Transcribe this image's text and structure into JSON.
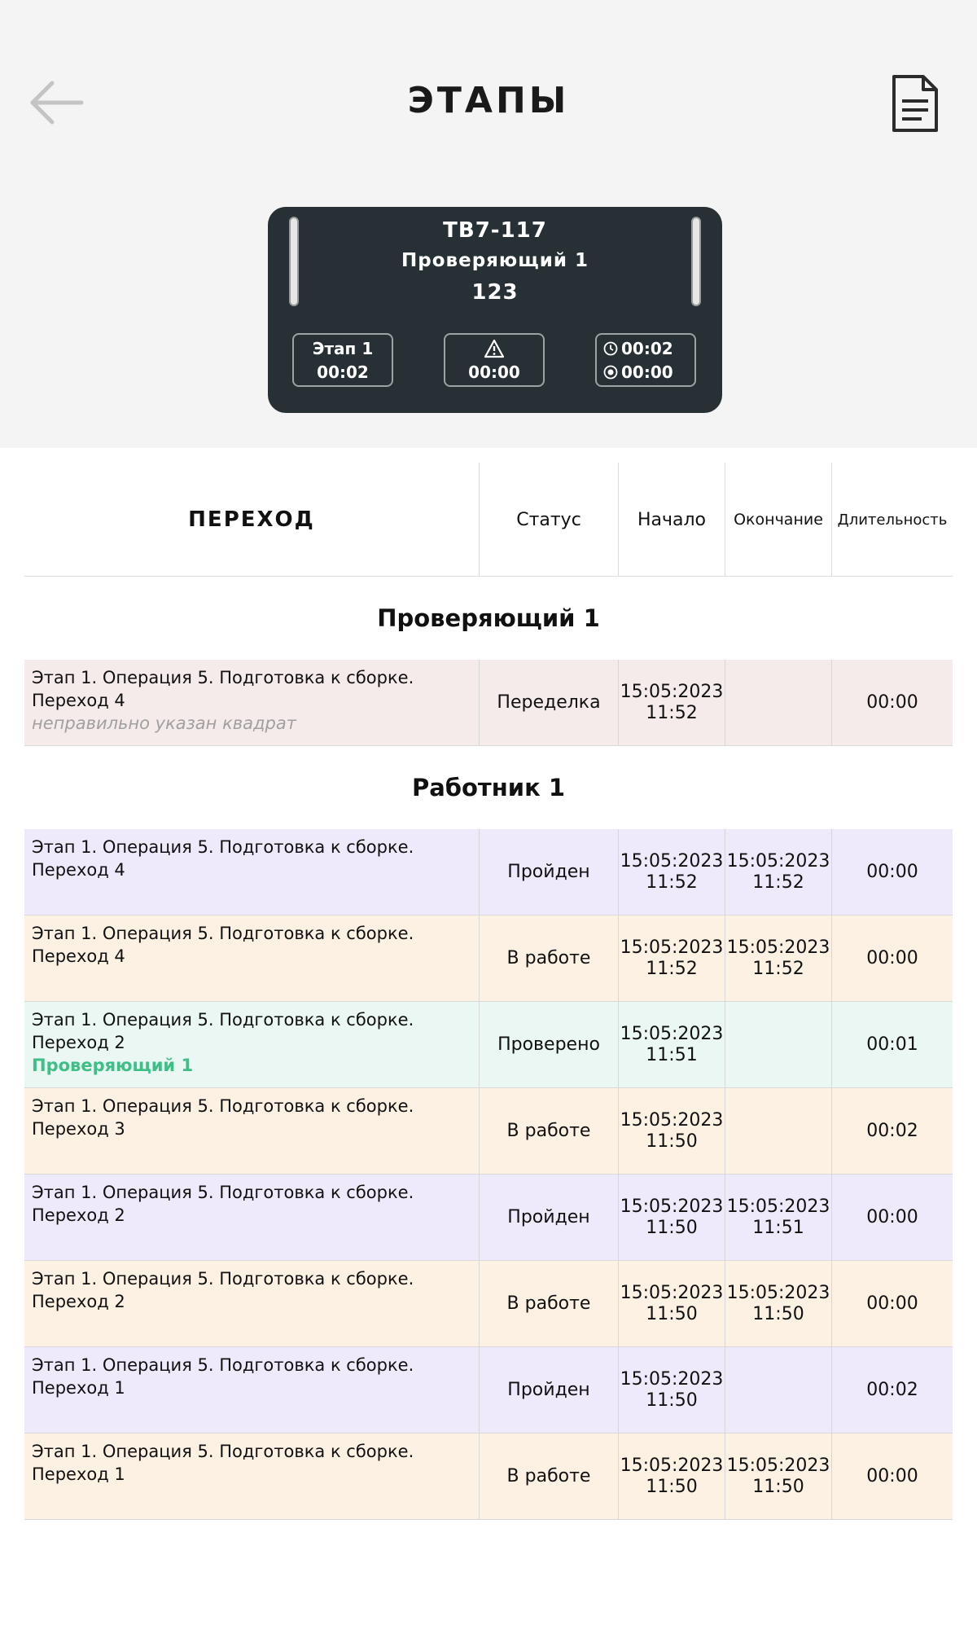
{
  "header": {
    "title": "ЭТАПЫ",
    "back_icon": "arrow-left-icon",
    "doc_icon": "document-icon"
  },
  "card": {
    "line1": "ТВ7-117",
    "line2": "Проверяющий 1",
    "line3": "123",
    "stage_label": "Этап 1",
    "stage_time": "00:02",
    "warning_time": "00:00",
    "clock_time": "00:02",
    "record_time": "00:00"
  },
  "table": {
    "headers": [
      "ПЕРЕХОД",
      "Статус",
      "Начало",
      "Окончание",
      "Длительность"
    ],
    "groups": [
      {
        "title": "Проверяющий 1",
        "rows": [
          {
            "line1": "Этап 1. Операция 5. Подготовка к сборке.",
            "line2": "Переход 4",
            "note": "неправильно указан квадрат",
            "reviewer": "",
            "status": "Переделка",
            "start_date": "15:05:2023",
            "start_time": "11:52",
            "end_date": "",
            "end_time": "",
            "duration": "00:00",
            "tone": "rework"
          }
        ]
      },
      {
        "title": "Работник 1",
        "rows": [
          {
            "line1": "Этап 1. Операция 5. Подготовка к сборке.",
            "line2": "Переход 4",
            "note": "",
            "reviewer": "",
            "status": "Пройден",
            "start_date": "15:05:2023",
            "start_time": "11:52",
            "end_date": "15:05:2023",
            "end_time": "11:52",
            "duration": "00:00",
            "tone": "passed"
          },
          {
            "line1": "Этап 1. Операция 5. Подготовка к сборке.",
            "line2": "Переход 4",
            "note": "",
            "reviewer": "",
            "status": "В работе",
            "start_date": "15:05:2023",
            "start_time": "11:52",
            "end_date": "15:05:2023",
            "end_time": "11:52",
            "duration": "00:00",
            "tone": "work"
          },
          {
            "line1": "Этап 1. Операция 5. Подготовка к сборке.",
            "line2": "Переход 2",
            "note": "",
            "reviewer": "Проверяющий 1",
            "status": "Проверено",
            "start_date": "15:05:2023",
            "start_time": "11:51",
            "end_date": "",
            "end_time": "",
            "duration": "00:01",
            "tone": "checked"
          },
          {
            "line1": "Этап 1. Операция 5. Подготовка к сборке.",
            "line2": "Переход 3",
            "note": "",
            "reviewer": "",
            "status": "В работе",
            "start_date": "15:05:2023",
            "start_time": "11:50",
            "end_date": "",
            "end_time": "",
            "duration": "00:02",
            "tone": "work"
          },
          {
            "line1": "Этап 1. Операция 5. Подготовка к сборке.",
            "line2": "Переход 2",
            "note": "",
            "reviewer": "",
            "status": "Пройден",
            "start_date": "15:05:2023",
            "start_time": "11:50",
            "end_date": "15:05:2023",
            "end_time": "11:51",
            "duration": "00:00",
            "tone": "passed"
          },
          {
            "line1": "Этап 1. Операция 5. Подготовка к сборке.",
            "line2": "Переход 2",
            "note": "",
            "reviewer": "",
            "status": "В работе",
            "start_date": "15:05:2023",
            "start_time": "11:50",
            "end_date": "15:05:2023",
            "end_time": "11:50",
            "duration": "00:00",
            "tone": "work"
          },
          {
            "line1": "Этап 1. Операция 5. Подготовка к сборке.",
            "line2": "Переход 1",
            "note": "",
            "reviewer": "",
            "status": "Пройден",
            "start_date": "15:05:2023",
            "start_time": "11:50",
            "end_date": "",
            "end_time": "",
            "duration": "00:02",
            "tone": "passed"
          },
          {
            "line1": "Этап 1. Операция 5. Подготовка к сборке.",
            "line2": "Переход 1",
            "note": "",
            "reviewer": "",
            "status": "В работе",
            "start_date": "15:05:2023",
            "start_time": "11:50",
            "end_date": "15:05:2023",
            "end_time": "11:50",
            "duration": "00:00",
            "tone": "work"
          }
        ]
      }
    ]
  },
  "colors": {
    "header_bg": "#f4f4f4",
    "card_bg": "#263035",
    "rework": "#f6ebeb",
    "passed": "#efeafb",
    "work": "#fdf1e4",
    "checked": "#eaf7f3",
    "reviewer_text": "#3dbf86"
  }
}
